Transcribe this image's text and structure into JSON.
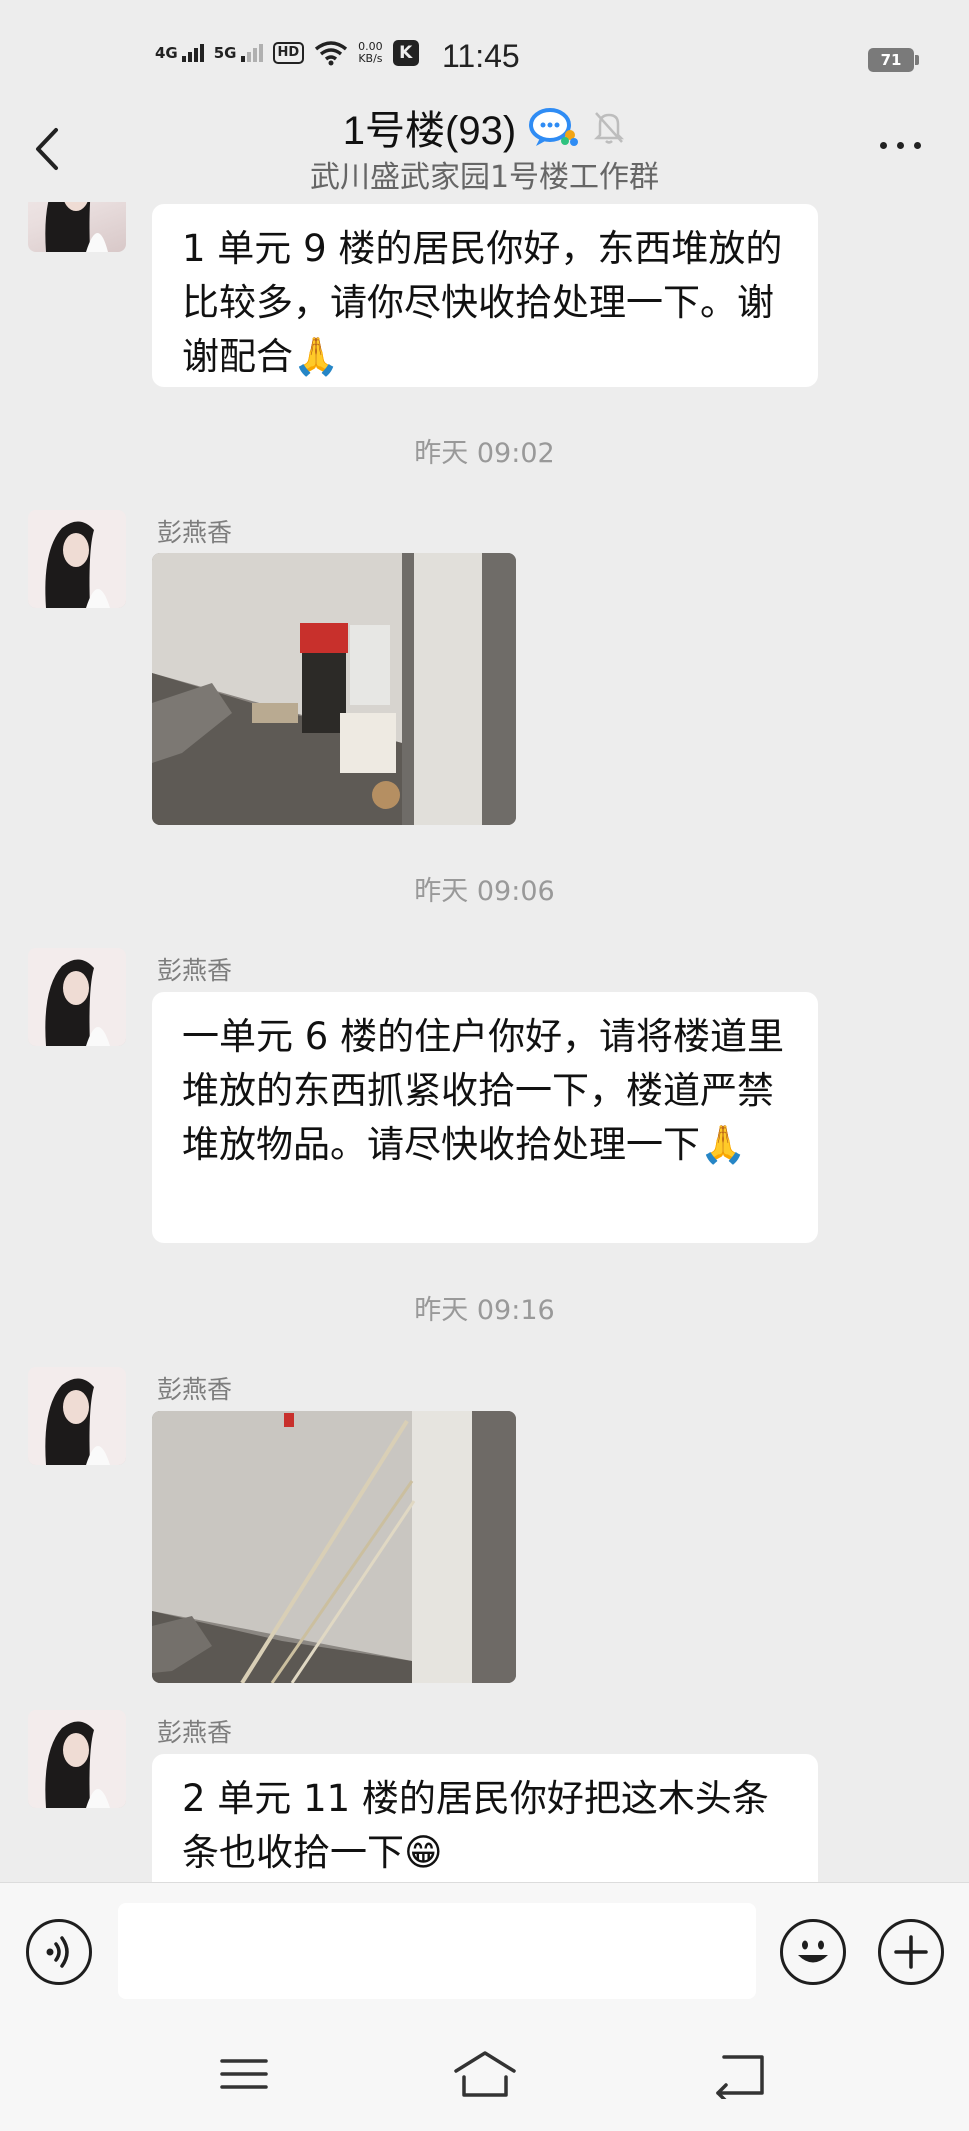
{
  "status_bar": {
    "signal1": "4G",
    "signal2": "5G",
    "hd_badge": "HD",
    "net_speed_value": "0.00",
    "net_speed_unit": "KB/s",
    "app_badge": "K",
    "time": "11:45",
    "battery": "71"
  },
  "header": {
    "title": "1号楼(93)",
    "subtitle": "武川盛武家园1号楼工作群"
  },
  "messages": [
    {
      "type": "text",
      "sender": "",
      "text": "1 单元 9 楼的居民你好，东西堆放的比较多，请你尽快收拾处理一下。谢谢配合🙏"
    },
    {
      "type": "timestamp",
      "text": "昨天 09:02"
    },
    {
      "type": "image",
      "sender": "彭燕香"
    },
    {
      "type": "timestamp",
      "text": "昨天 09:06"
    },
    {
      "type": "text",
      "sender": "彭燕香",
      "text": "一单元 6 楼的住户你好，请将楼道里堆放的东西抓紧收拾一下，楼道严禁堆放物品。请尽快收拾处理一下🙏"
    },
    {
      "type": "timestamp",
      "text": "昨天 09:16"
    },
    {
      "type": "image",
      "sender": "彭燕香"
    },
    {
      "type": "text",
      "sender": "彭燕香",
      "text": "2 单元 11 楼的居民你好把这木头条条也收拾一下😁"
    }
  ],
  "input": {
    "value": "",
    "placeholder": ""
  },
  "icons": {
    "back": "chevron-left-icon",
    "chat_bubble": "chat-bubbles-icon",
    "mute": "bell-off-icon",
    "more": "more-dots-icon",
    "voice": "voice-icon",
    "emoji": "emoji-icon",
    "add": "plus-circle-icon"
  },
  "colors": {
    "background": "#ededed",
    "bubble": "#ffffff",
    "timestamp": "#999999",
    "accent_blue": "#2f8cf4"
  }
}
